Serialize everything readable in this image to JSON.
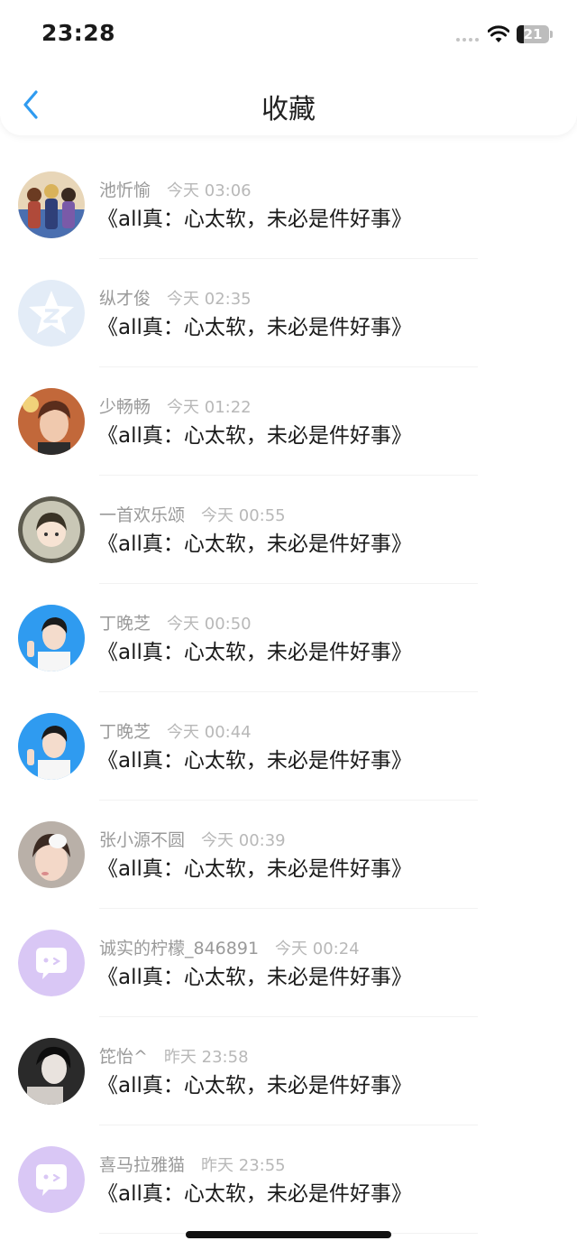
{
  "status_bar": {
    "time": "23:28",
    "battery": "21",
    "battery_percent": 21
  },
  "header": {
    "title": "收藏",
    "back_icon": "chevron-left-icon"
  },
  "items": [
    {
      "name": "池忻愉",
      "time": "今天 03:06",
      "content": "《all真：心太软，未必是件好事》",
      "avatar": "group-photo"
    },
    {
      "name": "纵才俊",
      "time": "今天 02:35",
      "content": "《all真：心太软，未必是件好事》",
      "avatar": "default-star-avatar"
    },
    {
      "name": "少畅畅",
      "time": "今天 01:22",
      "content": "《all真：心太软，未必是件好事》",
      "avatar": "portrait-photo"
    },
    {
      "name": "一首欢乐颂",
      "time": "今天 00:55",
      "content": "《all真：心太软，未必是件好事》",
      "avatar": "cartoon-portrait"
    },
    {
      "name": "丁晚芝",
      "time": "今天 00:50",
      "content": "《all真：心太软，未必是件好事》",
      "avatar": "blue-portrait"
    },
    {
      "name": "丁晚芝",
      "time": "今天 00:44",
      "content": "《all真：心太软，未必是件好事》",
      "avatar": "blue-portrait"
    },
    {
      "name": "张小源不圆",
      "time": "今天 00:39",
      "content": "《all真：心太软，未必是件好事》",
      "avatar": "selfie-photo"
    },
    {
      "name": "诚实的柠檬_846891",
      "time": "今天 00:24",
      "content": "《all真：心太软，未必是件好事》",
      "avatar": "default-chat-avatar"
    },
    {
      "name": "笓怡^",
      "time": "昨天 23:58",
      "content": "《all真：心太软，未必是件好事》",
      "avatar": "dark-photo"
    },
    {
      "name": "喜马拉雅猫",
      "time": "昨天 23:55",
      "content": "《all真：心太软，未必是件好事》",
      "avatar": "default-chat-avatar"
    }
  ],
  "colors": {
    "accent": "#2f9bf0",
    "lavender": "#d9c7f5"
  }
}
